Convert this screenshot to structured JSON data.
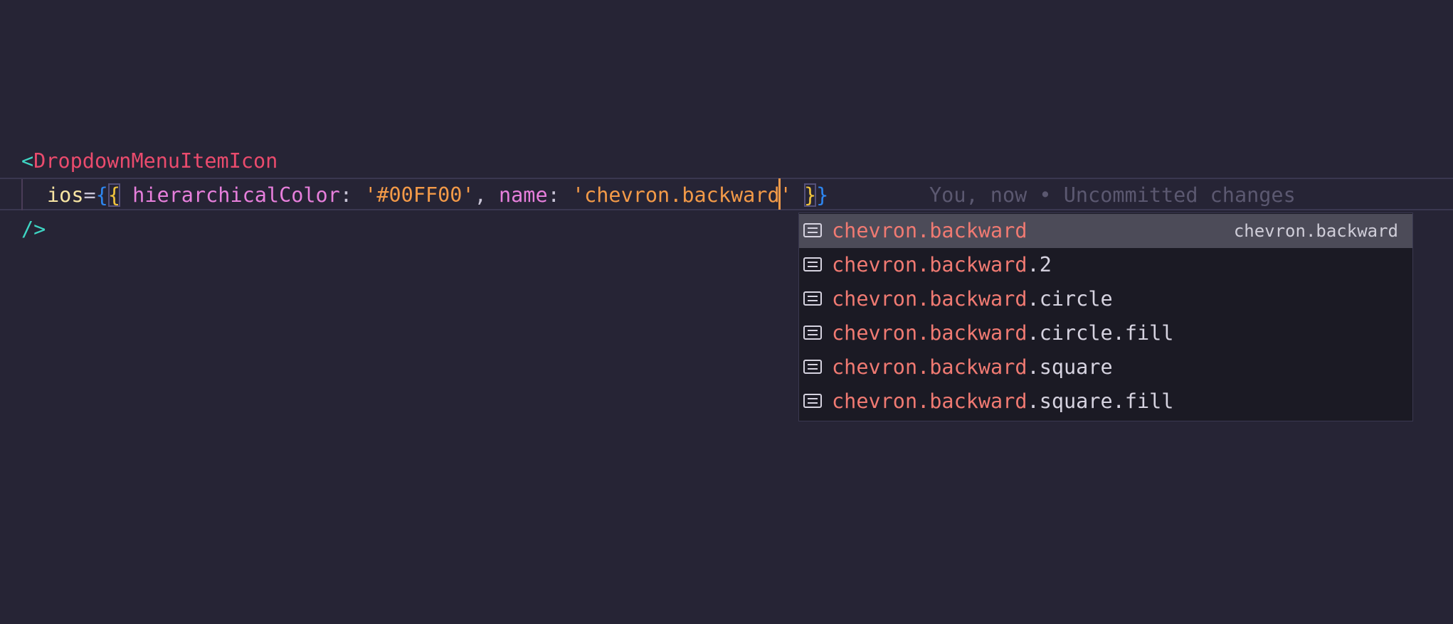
{
  "editor": {
    "line1": {
      "open_bracket": "<",
      "tag": "DropdownMenuItemIcon"
    },
    "line2": {
      "attr": "ios",
      "equals": "=",
      "brace_open_outer": "{",
      "brace_open_inner": "{",
      "space1": " ",
      "prop1": "hierarchicalColor",
      "colon1": ": ",
      "value1": "'#00FF00'",
      "comma": ", ",
      "prop2": "name",
      "colon2": ": ",
      "value2_typed": "'chevron.backward",
      "value2_after": "'",
      "space2": " ",
      "brace_close_inner": "}",
      "brace_close_outer": "}"
    },
    "line3": {
      "self_close": "/>"
    },
    "blame": "You, now • Uncommitted changes",
    "accent_color": "#f39a48"
  },
  "suggestions": {
    "items": [
      {
        "match": "chevron.backward",
        "rest": "",
        "detail": "chevron.backward",
        "icon": "text-icon",
        "selected": true
      },
      {
        "match": "chevron.backward",
        "rest": ".2",
        "detail": "",
        "icon": "text-icon",
        "selected": false
      },
      {
        "match": "chevron.backward",
        "rest": ".circle",
        "detail": "",
        "icon": "text-icon",
        "selected": false
      },
      {
        "match": "chevron.backward",
        "rest": ".circle.fill",
        "detail": "",
        "icon": "text-icon",
        "selected": false
      },
      {
        "match": "chevron.backward",
        "rest": ".square",
        "detail": "",
        "icon": "text-icon",
        "selected": false
      },
      {
        "match": "chevron.backward",
        "rest": ".square.fill",
        "detail": "",
        "icon": "text-icon",
        "selected": false
      }
    ],
    "match_color": "#f07a72",
    "selected_bg": "#4c4b58"
  }
}
